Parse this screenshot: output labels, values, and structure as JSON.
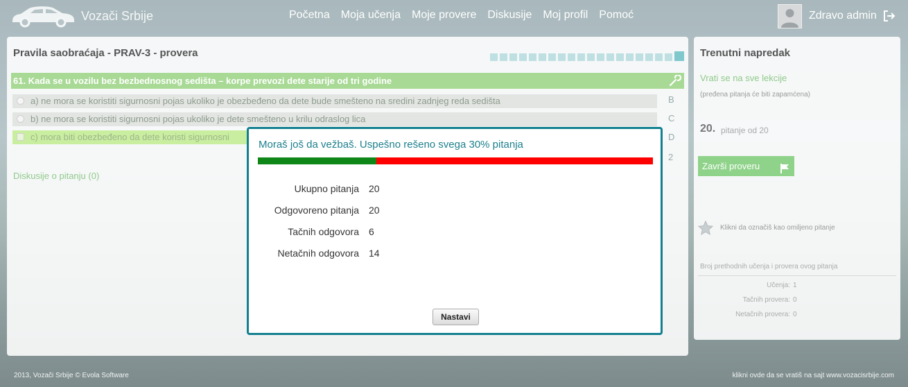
{
  "app": {
    "brand": "Vozači Srbije"
  },
  "nav": {
    "items": [
      "Početna",
      "Moja učenja",
      "Moje provere",
      "Diskusije",
      "Moj profil",
      "Pomoć"
    ]
  },
  "user": {
    "greeting": "Zdravo admin"
  },
  "main": {
    "title": "Pravila saobraćaja - PRAV-3 - provera",
    "progress_total": 20,
    "progress_current": 20,
    "question": "61.   Kada se u vozilu bez bezbednosnog sedišta – korpe prevozi dete starije od tri godine",
    "answers": [
      {
        "text": "a) ne mora se koristiti sigurnosni pojas ukoliko je obezbeđeno da dete bude smešteno na sredini zadnjeg reda sedišta",
        "selected": false
      },
      {
        "text": "b) ne mora se koristiti sigurnosni pojas ukoliko je dete smešteno u krilu odraslog lica",
        "selected": false
      },
      {
        "text": "c) mora biti obezbeđeno da dete koristi sigurnosni",
        "selected": true
      }
    ],
    "side_letters": [
      "B",
      "C",
      "D",
      "2"
    ],
    "discussion_link": "Diskusije o pitanju (0)"
  },
  "side": {
    "title": "Trenutni napredak",
    "back_link": "Vrati se na sve lekcije",
    "note": "(pređena pitanja će biti zapamćena)",
    "question_number": "20.",
    "question_of": "pitanje od 20",
    "finish_button": "Završi proveru",
    "favorite_text": "Klikni da označiš kao omiljeno pitanje",
    "stats_heading": "Broj prethodnih učenja i provera ovog pitanja",
    "stats": [
      {
        "label": "Učenja:",
        "value": "1"
      },
      {
        "label": "Tačnih provera:",
        "value": "0"
      },
      {
        "label": "Netačnih provera:",
        "value": "0"
      }
    ]
  },
  "footer": {
    "left": "2013, Vozači Srbije © Evola Software",
    "right": "klikni ovde da se vratiš na sajt  www.vozacisrbije.com"
  },
  "modal": {
    "title": "Moraš još da vežbaš. Uspešno rešeno svega 30% pitanja",
    "success_percent": 30,
    "rows": [
      {
        "label": "Ukupno pitanja",
        "value": "20"
      },
      {
        "label": "Odgovoreno pitanja",
        "value": "20"
      },
      {
        "label": "Tačnih odgovora",
        "value": "6"
      },
      {
        "label": "Netačnih odgovora",
        "value": "14"
      }
    ],
    "button": "Nastavi"
  },
  "colors": {
    "accent": "#11808f",
    "success": "#0e8618",
    "fail": "#ff0000",
    "question_bar": "#a8d995"
  }
}
